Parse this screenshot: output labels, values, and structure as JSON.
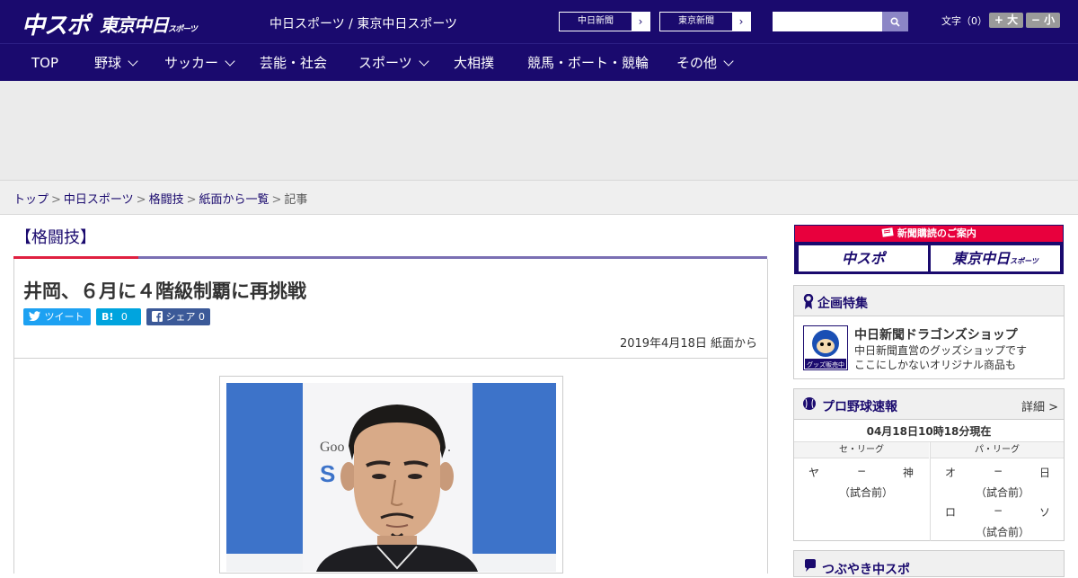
{
  "header": {
    "logo_chuspo": "中スポ",
    "logo_tokyo": "東京中日",
    "logo_tokyo_sub": "スポーツ",
    "site_name": "中日スポーツ / 東京中日スポーツ",
    "paper_links": [
      {
        "label": "中日新聞",
        "arrow": "›"
      },
      {
        "label": "東京新聞",
        "arrow": "›"
      }
    ],
    "search": {
      "placeholder": "",
      "value": ""
    },
    "font_size_label": "文字（0）",
    "font_up": "+ 大",
    "font_down": "− 小"
  },
  "nav": {
    "items": [
      {
        "label": "TOP",
        "has_dropdown": false
      },
      {
        "label": "野球",
        "has_dropdown": true
      },
      {
        "label": "サッカー",
        "has_dropdown": true
      },
      {
        "label": "芸能・社会",
        "has_dropdown": false
      },
      {
        "label": "スポーツ",
        "has_dropdown": true
      },
      {
        "label": "大相撲",
        "has_dropdown": false
      },
      {
        "label": "競馬・ボート・競輪",
        "has_dropdown": false
      },
      {
        "label": "その他",
        "has_dropdown": true
      }
    ]
  },
  "breadcrumb": {
    "items": [
      "トップ",
      "中日スポーツ",
      "格闘技",
      "紙面から一覧"
    ],
    "separator": ">",
    "current": "記事"
  },
  "article": {
    "category": "【格闘技】",
    "headline": "井岡、６月に４階級制覇に再挑戦",
    "share": {
      "tweet": "ツイート",
      "hatena_icon": "B!",
      "hatena_count": "0",
      "facebook_label": "シェア",
      "facebook_count": "0"
    },
    "dateline": "2019年4月18日 紙面から",
    "photo_backdrop_text": "Goo",
    "photo_backdrop_text2": "S"
  },
  "sidebar": {
    "subscription": {
      "header": "新聞購読のご案内",
      "tile1": "中スポ",
      "tile2": "東京中日",
      "tile2_sub": "スポーツ"
    },
    "special": {
      "title": "企画特集",
      "item_title": "中日新聞ドラゴンズショップ",
      "item_desc_1": "中日新聞直営のグッズショップです",
      "item_desc_2": "ここにしかないオリジナル商品も",
      "thumb_label": "グッズ販売中"
    },
    "baseball": {
      "title": "プロ野球速報",
      "detail_link": "詳細 >",
      "timestamp": "04月18日10時18分現在",
      "central": {
        "name": "セ・リーグ",
        "games": [
          {
            "home": "ヤ",
            "dash": "−",
            "away": "神",
            "status": "（試合前）"
          }
        ]
      },
      "pacific": {
        "name": "パ・リーグ",
        "games": [
          {
            "home": "オ",
            "dash": "−",
            "away": "日",
            "status": "（試合前）"
          },
          {
            "home": "ロ",
            "dash": "−",
            "away": "ソ",
            "status": "（試合前）"
          }
        ]
      }
    },
    "next_panel_title": "つぶやき中スポ"
  },
  "colors": {
    "brand_navy": "#1a0a6e",
    "accent_red": "#e02040",
    "twitter": "#1da1f2",
    "hatena": "#00a4de",
    "facebook": "#3b5998"
  }
}
